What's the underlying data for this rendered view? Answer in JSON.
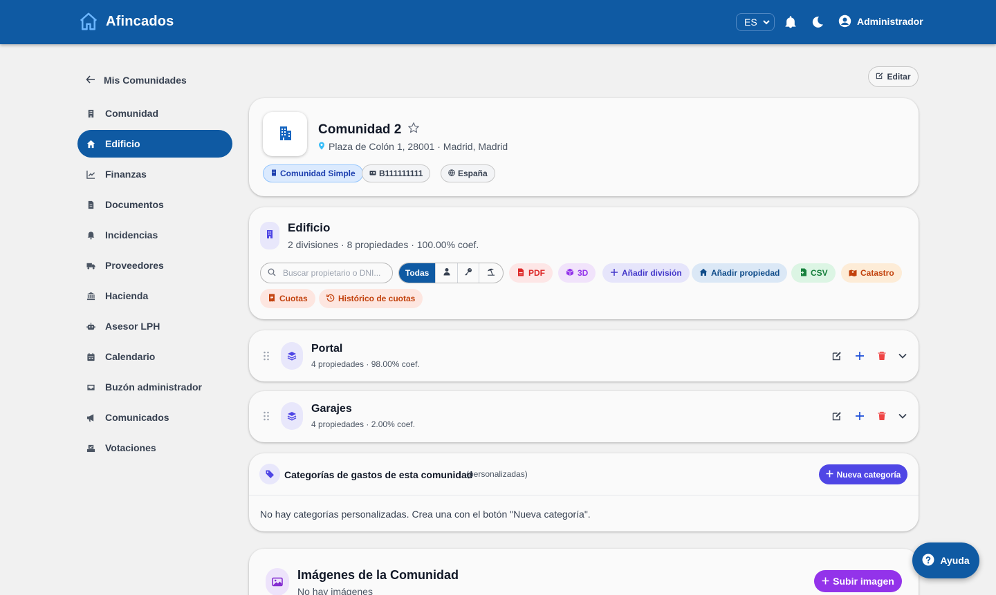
{
  "app": {
    "name": "Afincados",
    "language": "ES",
    "user": "Administrador"
  },
  "sidebar": {
    "back_label": "Mis Comunidades",
    "items": [
      {
        "label": "Comunidad",
        "icon": "building-icon",
        "active": false
      },
      {
        "label": "Edificio",
        "icon": "home-icon",
        "active": true
      },
      {
        "label": "Finanzas",
        "icon": "chart-line-icon",
        "active": false
      },
      {
        "label": "Documentos",
        "icon": "document-icon",
        "active": false
      },
      {
        "label": "Incidencias",
        "icon": "bell-icon",
        "active": false
      },
      {
        "label": "Proveedores",
        "icon": "truck-icon",
        "active": false
      },
      {
        "label": "Hacienda",
        "icon": "bank-icon",
        "active": false
      },
      {
        "label": "Asesor LPH",
        "icon": "robot-icon",
        "active": false
      },
      {
        "label": "Calendario",
        "icon": "calendar-icon",
        "active": false
      },
      {
        "label": "Buzón administrador",
        "icon": "inbox-icon",
        "active": false
      },
      {
        "label": "Comunicados",
        "icon": "megaphone-icon",
        "active": false
      },
      {
        "label": "Votaciones",
        "icon": "ballot-box-icon",
        "active": false
      }
    ]
  },
  "edit_button": "Editar",
  "community": {
    "name": "Comunidad 2",
    "address": "Plaza de Colón 1, 28001 · Madrid, Madrid",
    "chips": {
      "type": "Comunidad Simple",
      "cif": "B111111111",
      "country": "España"
    }
  },
  "building": {
    "title": "Edificio",
    "summary": "2 divisiones · 8 propiedades · 100.00% coef.",
    "search_placeholder": "Buscar propietario o DNI...",
    "filter_all": "Todas",
    "actions": {
      "pdf": "PDF",
      "three_d": "3D",
      "add_division": "Añadir división",
      "add_property": "Añadir propiedad",
      "csv": "CSV",
      "catastro": "Catastro",
      "quotas": "Cuotas",
      "quota_history": "Histórico de cuotas"
    }
  },
  "divisions": [
    {
      "name": "Portal",
      "summary": "4 propiedades · 98.00% coef."
    },
    {
      "name": "Garajes",
      "summary": "4 propiedades · 2.00% coef."
    }
  ],
  "categories": {
    "title": "Categorías de gastos de esta comunidad",
    "note": "(personalizadas)",
    "button": "Nueva categoría",
    "empty": "No hay categorías personalizadas. Crea una con el botón \"Nueva categoría\"."
  },
  "images": {
    "title": "Imágenes de la Comunidad",
    "subtitle": "No hay imágenes",
    "button": "Subir imagen"
  },
  "help_button": "Ayuda",
  "colors": {
    "primary": "#0f5aa3",
    "accent": "#4f46e5",
    "purple": "#9333ea",
    "danger": "#ef4444"
  }
}
